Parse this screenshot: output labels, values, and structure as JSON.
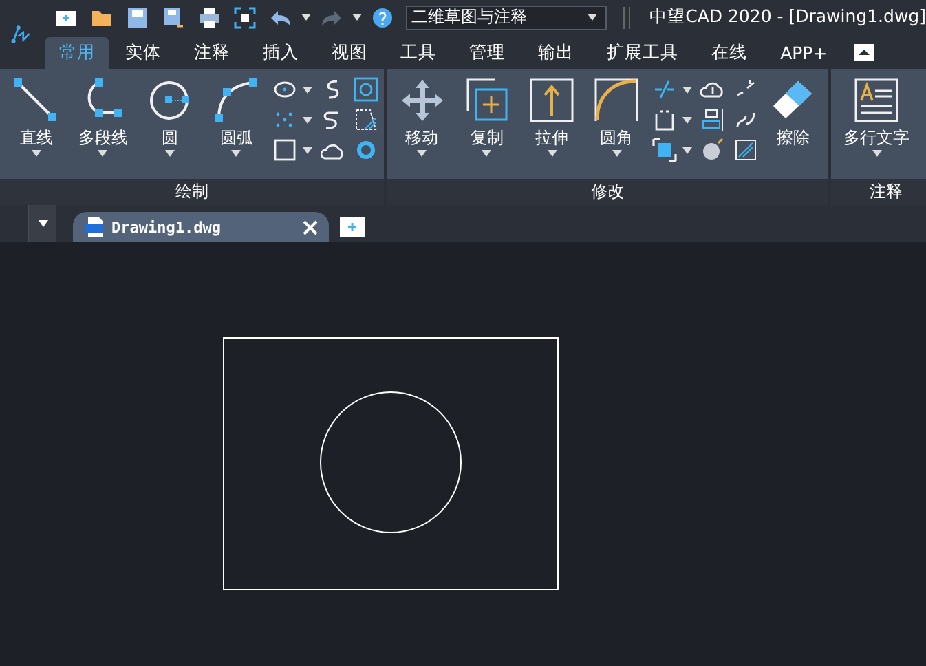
{
  "quick_access": {
    "workspace": "二维草图与注释"
  },
  "window": {
    "title": "中望CAD 2020 - [Drawing1.dwg]"
  },
  "ribbon_tabs": [
    {
      "label": "常用",
      "selected": true
    },
    {
      "label": "实体",
      "selected": false
    },
    {
      "label": "注释",
      "selected": false
    },
    {
      "label": "插入",
      "selected": false
    },
    {
      "label": "视图",
      "selected": false
    },
    {
      "label": "工具",
      "selected": false
    },
    {
      "label": "管理",
      "selected": false
    },
    {
      "label": "输出",
      "selected": false
    },
    {
      "label": "扩展工具",
      "selected": false
    },
    {
      "label": "在线",
      "selected": false
    },
    {
      "label": "APP+",
      "selected": false
    }
  ],
  "panels": [
    {
      "title": "绘制",
      "tools": [
        {
          "kind": "line",
          "label": "直线"
        },
        {
          "kind": "polyline",
          "label": "多段线"
        },
        {
          "kind": "circle",
          "label": "圆"
        },
        {
          "kind": "arc",
          "label": "圆弧"
        }
      ],
      "small_tools": {
        "kind": "draw"
      }
    },
    {
      "title": "修改",
      "tools": [
        {
          "kind": "move",
          "label": "移动"
        },
        {
          "kind": "copy",
          "label": "复制"
        },
        {
          "kind": "stretch",
          "label": "拉伸"
        },
        {
          "kind": "fillet",
          "label": "圆角"
        }
      ],
      "small_tools": {
        "kind": "modify"
      },
      "extra_tool": {
        "kind": "erase",
        "label": "擦除"
      }
    },
    {
      "title": "注释",
      "tools": [
        {
          "kind": "mtext",
          "label": "多行文字"
        }
      ]
    }
  ],
  "document_tabs": [
    {
      "label": "Drawing1.dwg",
      "selected": true
    }
  ]
}
